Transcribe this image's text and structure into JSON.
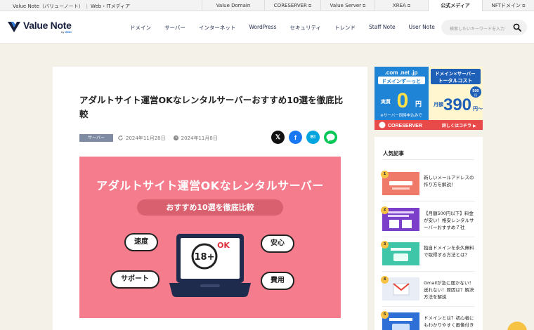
{
  "topbar": {
    "site_name": "Value Note（バリューノート）",
    "site_tag": "Web・ITメディア",
    "links": [
      {
        "label": "Value Domain",
        "ext": false,
        "active": false
      },
      {
        "label": "CORESERVER",
        "ext": true,
        "active": false
      },
      {
        "label": "Value Server",
        "ext": true,
        "active": false
      },
      {
        "label": "XREA",
        "ext": true,
        "active": false
      },
      {
        "label": "公式メディア",
        "ext": false,
        "active": true
      },
      {
        "label": "NFTドメイン",
        "ext": true,
        "active": false
      }
    ]
  },
  "header": {
    "logo_text": "Value Note",
    "logo_by": "by",
    "logo_gmo": "GMO",
    "nav": [
      "ドメイン",
      "サーバー",
      "インターネット",
      "WordPress",
      "セキュリティ",
      "トレンド",
      "Staff Note",
      "User Note"
    ],
    "search_placeholder": "検索したいキーワードを入力"
  },
  "article": {
    "title": "アダルトサイト運営OKなレンタルサーバーおすすめ10選を徹底比較",
    "category": "サーバー",
    "updated": "2024年11月28日",
    "published": "2024年11月8日",
    "share_buttons": [
      {
        "name": "x-share-icon",
        "glyph": "𝕏"
      },
      {
        "name": "facebook-share-icon",
        "glyph": "f"
      },
      {
        "name": "hatena-share-icon",
        "glyph": "B!"
      },
      {
        "name": "line-share-icon",
        "glyph": "L"
      }
    ],
    "hero": {
      "heading": "アダルトサイト運営OKなレンタルサーバー",
      "pill": "おすすめ10選を徹底比較",
      "bubbles": [
        "速度",
        "安心",
        "サポート",
        "費用"
      ],
      "screen_text": "18+",
      "screen_ok": "OK"
    }
  },
  "ad": {
    "left_top": ".com .net .jp",
    "left_mid": "ドメインずーっと",
    "left_big_pre": "実質",
    "left_big": "0",
    "left_big_post": "円",
    "left_note": "※サーバー同時申込みで",
    "right_top1": "ドメイン×サーバー",
    "right_top2": "トータルコスト",
    "right_pre": "月額",
    "right_big": "390",
    "right_post": "円〜",
    "right_badge1": "500",
    "right_badge2": "円",
    "bottom_brand": "CORESERVER",
    "bottom_cta": "詳しくはコチラ ▶"
  },
  "popular": {
    "heading": "人気記事",
    "items": [
      {
        "rank": "1",
        "title": "新しいメールアドレスの作り方を解説！",
        "color": "#f07a6a"
      },
      {
        "rank": "2",
        "title": "【月額500円以下】料金が安い！格安レンタルサーバーおすすめ７社",
        "color": "#7b3fc9"
      },
      {
        "rank": "3",
        "title": "独自ドメインを永久無料で取得する方法とは？",
        "color": "#3fc6a8"
      },
      {
        "rank": "4",
        "title": "Gmailが急に届かない！送れない！原因は？解決方法を解説",
        "color": "#e9eef6"
      },
      {
        "rank": "5",
        "title": "ドメインとは？初心者にもわかりやすく画像付き",
        "color": "#2d6fd6"
      }
    ]
  },
  "colors": {
    "accent_pink": "#f47c8c",
    "brand_navy": "#17203d",
    "rank_badge": "#f6c344"
  }
}
